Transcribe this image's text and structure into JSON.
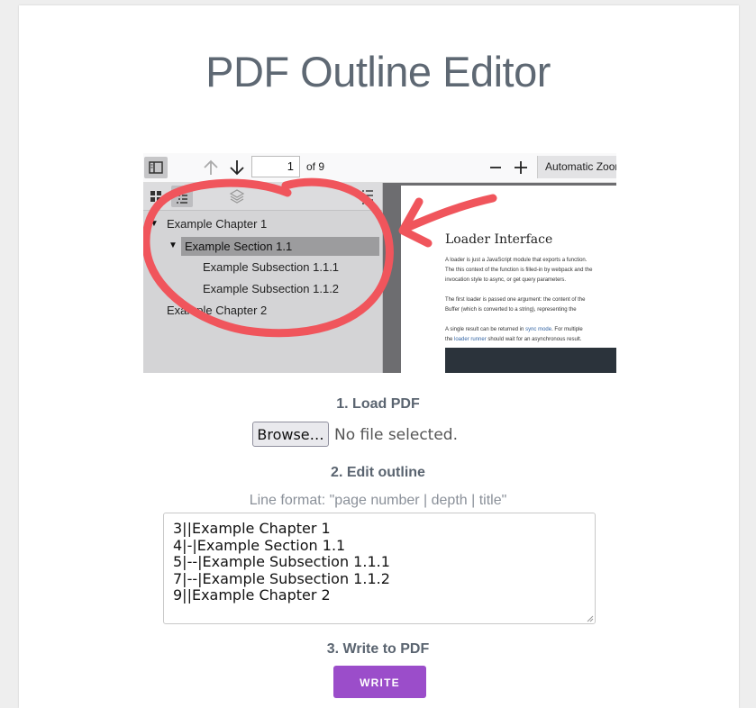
{
  "page": {
    "title": "PDF Outline Editor"
  },
  "preview": {
    "toolbar": {
      "page_number": "1",
      "page_count": "of 9",
      "zoom": "Automatic Zoom",
      "sidebar_toggle_icon": "sidebar-toggle-icon",
      "prev_icon": "arrow-up-icon",
      "next_icon": "arrow-down-icon",
      "zoom_out_icon": "minus-icon",
      "zoom_in_icon": "plus-icon"
    },
    "sidebar_tools": [
      "thumbnails-icon",
      "outline-icon",
      "layers-icon",
      "current-outline-item-icon"
    ],
    "outline": [
      {
        "label": "Example Chapter 1",
        "expanded": true
      },
      {
        "label": "Example Section 1.1",
        "expanded": true,
        "selected": true
      },
      {
        "label": "Example Subsection 1.1.1"
      },
      {
        "label": "Example Subsection 1.1.2"
      },
      {
        "label": "Example Chapter 2"
      }
    ],
    "document": {
      "heading": "Loader Interface",
      "para1": [
        "A loader is just a JavaScript module that exports a function.",
        "The this context of the function is filled-in by webpack and the",
        "invocation style to async, or get query parameters."
      ],
      "para2": [
        "The first loader is passed one argument: the content of the",
        "Buffer (which is converted to a string), representing the"
      ],
      "para3_pre": "A single result can be returned in ",
      "para3_link": "sync mode",
      "para3_post": ". For multiple",
      "para3_line2_pre": "the ",
      "para3_line2_link": "loader runner",
      "para3_line2_post": " should wait for an asynchronous result."
    },
    "annotation": {
      "color": "#f0555c"
    }
  },
  "steps": {
    "load": "1. Load PDF",
    "edit": "2. Edit outline",
    "write": "3. Write to PDF"
  },
  "file_input": {
    "button_label": "Browse…",
    "status": "No file selected."
  },
  "outline_editor": {
    "format_hint": "Line format: \"page number | depth | title\"",
    "lines": [
      "3||Example Chapter 1",
      "4|-|Example Section 1.1",
      "5|--|Example Subsection 1.1.1",
      "7|--|Example Subsection 1.1.2",
      "9||Example Chapter 2"
    ]
  },
  "write_button": {
    "label": "WRITE",
    "color": "#9b4dca"
  }
}
